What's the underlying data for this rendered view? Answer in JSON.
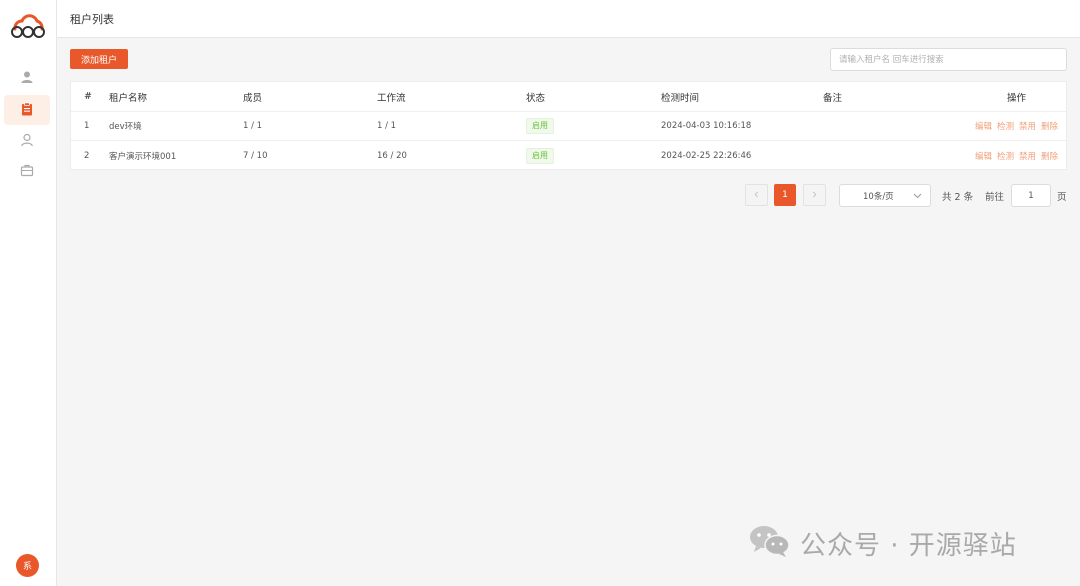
{
  "header": {
    "title": "租户列表"
  },
  "sidebar": {
    "items": [
      {
        "icon": "user-icon",
        "active": false
      },
      {
        "icon": "clipboard-icon",
        "active": true
      },
      {
        "icon": "user-outline-icon",
        "active": false
      },
      {
        "icon": "briefcase-icon",
        "active": false
      }
    ],
    "avatar_text": "系"
  },
  "toolbar": {
    "add_label": "添加租户",
    "search_placeholder": "请输入租户名 回车进行搜索"
  },
  "table": {
    "columns": [
      "#",
      "租户名称",
      "成员",
      "工作流",
      "状态",
      "检测时间",
      "备注",
      "操作"
    ],
    "rows": [
      {
        "index": "1",
        "name": "dev环境",
        "members": "1 / 1",
        "workflows": "1 / 1",
        "status": "启用",
        "time": "2024-04-03 10:16:18",
        "remark": ""
      },
      {
        "index": "2",
        "name": "客户演示环境001",
        "members": "7 / 10",
        "workflows": "16 / 20",
        "status": "启用",
        "time": "2024-02-25 22:26:46",
        "remark": ""
      }
    ],
    "actions": [
      "编辑",
      "检测",
      "禁用",
      "删除"
    ]
  },
  "pagination": {
    "current_page": "1",
    "page_size": "10条/页",
    "total_text": "共 2 条",
    "goto_label": "前往",
    "goto_value": "1",
    "goto_suffix": "页"
  },
  "watermark": {
    "text": "公众号 · 开源驿站",
    "icon": "wechat-icon"
  },
  "colors": {
    "accent": "#e8582a",
    "status_green": "#67c23a",
    "action_link": "#f0a07a"
  }
}
